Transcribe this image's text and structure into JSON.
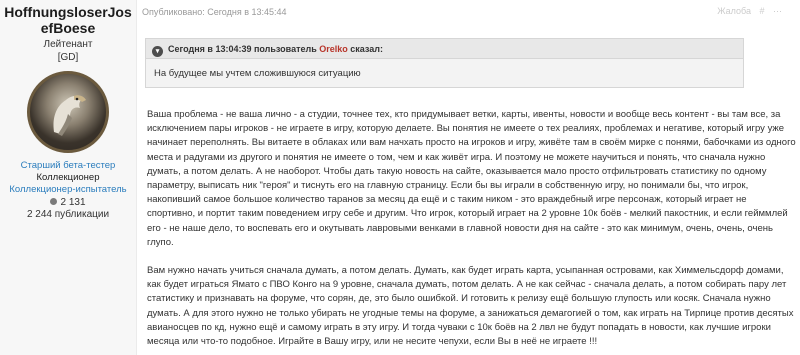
{
  "author": {
    "name": "HoffnungsloserJosefBoese",
    "rank": "Лейтенант",
    "clan": "[GD]",
    "badges": [
      "Старший бета-тестер",
      "Коллекционер",
      "Коллекционер-испытатель"
    ],
    "reputation": "2 131",
    "posts": "2 244 публикации"
  },
  "post": {
    "published": "Опубликовано: Сегодня в 13:45:44",
    "tools": [
      "Жалоба",
      "#",
      "⋯"
    ],
    "quote": {
      "prefix": "Сегодня в 13:04:39 пользователь ",
      "user": "Orelko",
      "suffix": " сказал:",
      "text": "На будущее мы учтем сложившуюся ситуацию"
    },
    "paragraphs": [
      "Ваша проблема - не ваша лично - а студии, точнее тех, кто придумывает ветки, карты, ивенты, новости и вообще весь контент - вы там все, за исключением пары игроков - не играете в игру, которую делаете. Вы понятия не имеете о тех реалиях, проблемах и негативе, который игру уже начинает переполнять. Вы витаете в облаках или вам начхать просто на игроков и игру, живёте там в своём мирке с понями, бабочками из одного места и радугами из другого и понятия не имеете о том, чем и как живёт игра. И поэтому не можете научиться и понять, что сначала нужно думать, а потом делать. А не наоборот. Чтобы дать такую новость на сайте, оказывается мало просто отфильтровать статистику по одному параметру, выписать ник \"героя\" и тиснуть его на главную страницу. Если бы вы играли в собственную игру, но понимали бы, что игрок, накопивший самое большое количество таранов за месяц да ещё и с таким ником - это враждебный игре персонаж, который играет не спортивно, и портит таким поведением игру себе и другим. Что игрок, который играет на 2 уровне 10к боёв - мелкий пакостник, и если гейммлей его - не наше дело, то воспевать его и окутывать лавровыми венками в главной новости дня на сайте - это как минимум, очень, очень, очень глупо.",
      "Вам нужно начать учиться сначала думать, а потом делать. Думать, как будет играть карта, усыпанная островами, как Химмельсдорф домами, как будет играться Ямато с ПВО Конго на 9 уровне, сначала думать, потом делать. А не как сейчас - сначала делать, а потом собирать пару лет статистику и признавать на форуме, что сорян, де, это было ошибкой. И готовить к релизу ещё большую глупость или косяк. Сначала нужно думать. А для этого нужно не только убирать не угодные темы на форуме, а занижаться демагогией о том, как играть на Тирпице против десятых авианосцев по кд, нужно ещё и самому играть в эту игру. И тогда чуваки с 10к боёв на 2 лвл не будут попадать в новости, как лучшие игроки месяца или что-то подобное. Играйте в Вашу игру, или не несите чепухи, если Вы в неё не играете !!!"
    ]
  }
}
